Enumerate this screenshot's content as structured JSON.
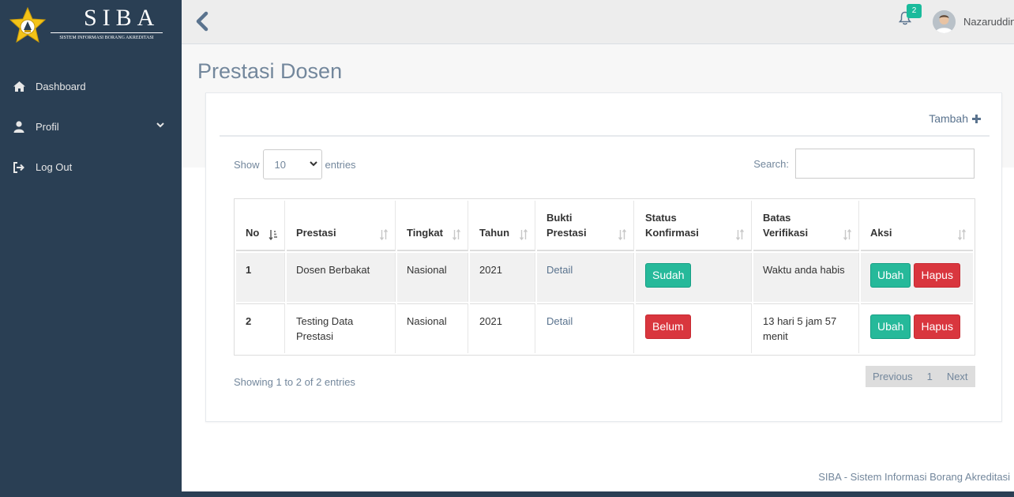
{
  "brand": {
    "title": "SIBA",
    "subtitle": "SISTEM INFORMASI BORANG AKREDITASI"
  },
  "sidebar": {
    "items": [
      {
        "label": "Dashboard",
        "icon": "home-icon"
      },
      {
        "label": "Profil",
        "icon": "user-icon"
      },
      {
        "label": "Log Out",
        "icon": "sign-out-icon"
      }
    ]
  },
  "topbar": {
    "notification_count": "2",
    "username": "Nazaruddin"
  },
  "page": {
    "title": "Prestasi Dosen",
    "add_label": "Tambah"
  },
  "table_controls": {
    "show_label": "Show",
    "length_value": "10",
    "entries_label": "entries",
    "search_label": "Search:",
    "search_value": ""
  },
  "table": {
    "columns": [
      "No",
      "Prestasi",
      "Tingkat",
      "Tahun",
      "Bukti Prestasi",
      "Status Konfirmasi",
      "Batas Verifikasi",
      "Aksi"
    ],
    "header_lines": {
      "bukti": [
        "Bukti",
        "Prestasi"
      ],
      "status": [
        "Status",
        "Konfirmasi"
      ],
      "batas": [
        "Batas",
        "Verifikasi"
      ]
    },
    "rows": [
      {
        "no": "1",
        "prestasi": "Dosen Berbakat",
        "tingkat": "Nasional",
        "tahun": "2021",
        "bukti": "Detail",
        "status": "Sudah",
        "status_color": "#26B99A",
        "batas": "Waktu anda habis",
        "edit": "Ubah",
        "delete": "Hapus"
      },
      {
        "no": "2",
        "prestasi": "Testing Data Prestasi",
        "tingkat": "Nasional",
        "tahun": "2021",
        "bukti": "Detail",
        "status": "Belum",
        "status_color": "#d9363e",
        "batas": "13 hari 5 jam 57 menit",
        "edit": "Ubah",
        "delete": "Hapus"
      }
    ]
  },
  "pagination": {
    "info": "Showing 1 to 2 of 2 entries",
    "previous": "Previous",
    "page": "1",
    "next": "Next"
  },
  "footer": {
    "text": "SIBA - Sistem Informasi Borang Akreditasi"
  },
  "colors": {
    "sidebar_bg": "#2A3F54",
    "success": "#26B99A",
    "danger": "#d9363e",
    "badge": "#1ABB9C"
  }
}
